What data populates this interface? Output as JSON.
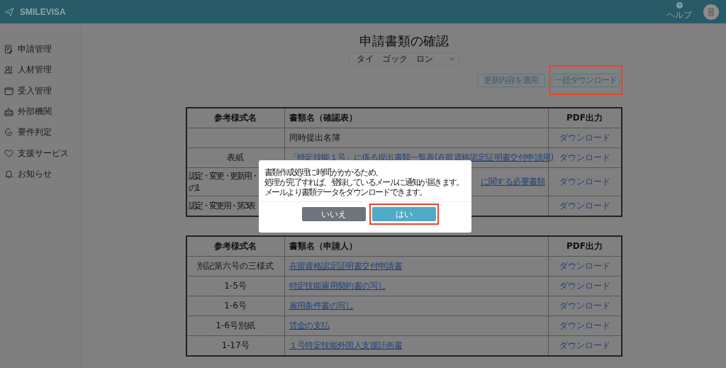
{
  "header": {
    "brand": "SMILEVISA",
    "help_label": "ヘルプ"
  },
  "sidebar": {
    "items": [
      {
        "label": "申請管理"
      },
      {
        "label": "人材管理"
      },
      {
        "label": "受入管理"
      },
      {
        "label": "外部機関"
      },
      {
        "label": "要件判定"
      },
      {
        "label": "支援サービス"
      },
      {
        "label": "お知らせ"
      }
    ]
  },
  "page": {
    "title": "申請書類の確認",
    "applicant_select": {
      "value": "タイ　ゴック　ロン"
    },
    "actions": [
      {
        "label": "更新内容を適用",
        "highlighted": false
      },
      {
        "label": "一括ダウンロード",
        "highlighted": true
      }
    ]
  },
  "tables": [
    {
      "columns": [
        "参考様式名",
        "書類名（確認表）",
        "PDF出力"
      ],
      "rows": [
        {
          "document": "同時提出名簿",
          "link": false,
          "pdf": "ダウンロード"
        },
        {
          "form": [
            "表紙"
          ],
          "form_clipped": false,
          "document": "「特定技能１号」に係る提出書類一覧表(在留資格認定証明書交付申請用)",
          "link": true,
          "pdf": "ダウンロード"
        },
        {
          "form": [
            "認定・変更・更新用・",
            "の1"
          ],
          "form_clipped": true,
          "document": "に関する必要書類",
          "document_clipped": true,
          "link": true,
          "pdf": "ダウンロード"
        },
        {
          "form": [
            "認定・変更用・第3表"
          ],
          "form_clipped": true,
          "pdf": "ダウンロード"
        }
      ]
    },
    {
      "columns": [
        "参考様式名",
        "書類名（申請人）",
        "PDF出力"
      ],
      "rows": [
        {
          "form": [
            "別記第六号の三様式"
          ],
          "form_clipped": false,
          "document": "在留資格認定証明書交付申請書",
          "link": true,
          "pdf": "ダウンロード"
        },
        {
          "form": [
            "1-5号"
          ],
          "form_clipped": false,
          "document": "特定技能雇用契約書の写し",
          "link": true,
          "pdf": "ダウンロード"
        },
        {
          "form": [
            "1-6号"
          ],
          "form_clipped": false,
          "document": "雇用条件書の写し",
          "link": true,
          "pdf": "ダウンロード"
        },
        {
          "form": [
            "1-6号別紙"
          ],
          "form_clipped": false,
          "document": "賃金の支払",
          "link": true,
          "pdf": "ダウンロード"
        },
        {
          "form": [
            "1-17号"
          ],
          "form_clipped": false,
          "document": "１号特定技能外国人支援計画書",
          "link": true,
          "pdf": "ダウンロード"
        }
      ]
    }
  ],
  "modal": {
    "message_lines": [
      "書類作成処理に時間がかかるため、",
      "処理が完了すれば、登録しているメールに通知が届きます。",
      "メールより書類データをダウンロードできます。"
    ],
    "buttons": [
      {
        "label": "いいえ",
        "kind": "secondary",
        "highlighted": false
      },
      {
        "label": "はい",
        "kind": "primary",
        "highlighted": true
      }
    ]
  }
}
